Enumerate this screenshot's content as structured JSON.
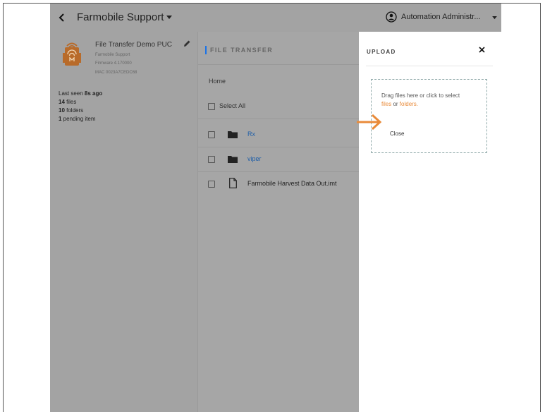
{
  "header": {
    "title": "Farmobile Support",
    "user_name": "Automation Administr..."
  },
  "device": {
    "name": "File Transfer Demo PUC",
    "org": "Farmobile Support",
    "firmware": "Firmware 4.170000",
    "mac": "MAC 0023A7CEDC68"
  },
  "stats": {
    "last_seen_prefix": "Last seen ",
    "last_seen_value": "8s ago",
    "files_count": "14",
    "files_label": " files",
    "folders_count": "10",
    "folders_label": " folders",
    "pending_count": "1",
    "pending_label": " pending item"
  },
  "file_transfer": {
    "title": "FILE TRANSFER",
    "breadcrumb": "Home",
    "select_all": "Select All",
    "items": [
      {
        "name": "Rx",
        "type": "folder"
      },
      {
        "name": "viper",
        "type": "folder"
      },
      {
        "name": "Farmobile Harvest Data Out.imt",
        "type": "file"
      }
    ]
  },
  "upload": {
    "title": "UPLOAD",
    "drop_text": "Drag files here or click to select",
    "files_link": "files",
    "or_text": " or ",
    "folders_link": "folders.",
    "close_label": "Close"
  },
  "colors": {
    "accent_orange": "#e98b3a",
    "link_blue": "#1f5fa8",
    "overlay_gray": "#a6a6a6"
  },
  "icons": {
    "back": "chevron-left-icon",
    "caret": "caret-down-icon",
    "user": "user-circle-icon",
    "edit": "pencil-icon",
    "folder": "folder-icon",
    "file": "file-icon",
    "close": "close-icon",
    "annotation": "arrow-right-icon"
  }
}
